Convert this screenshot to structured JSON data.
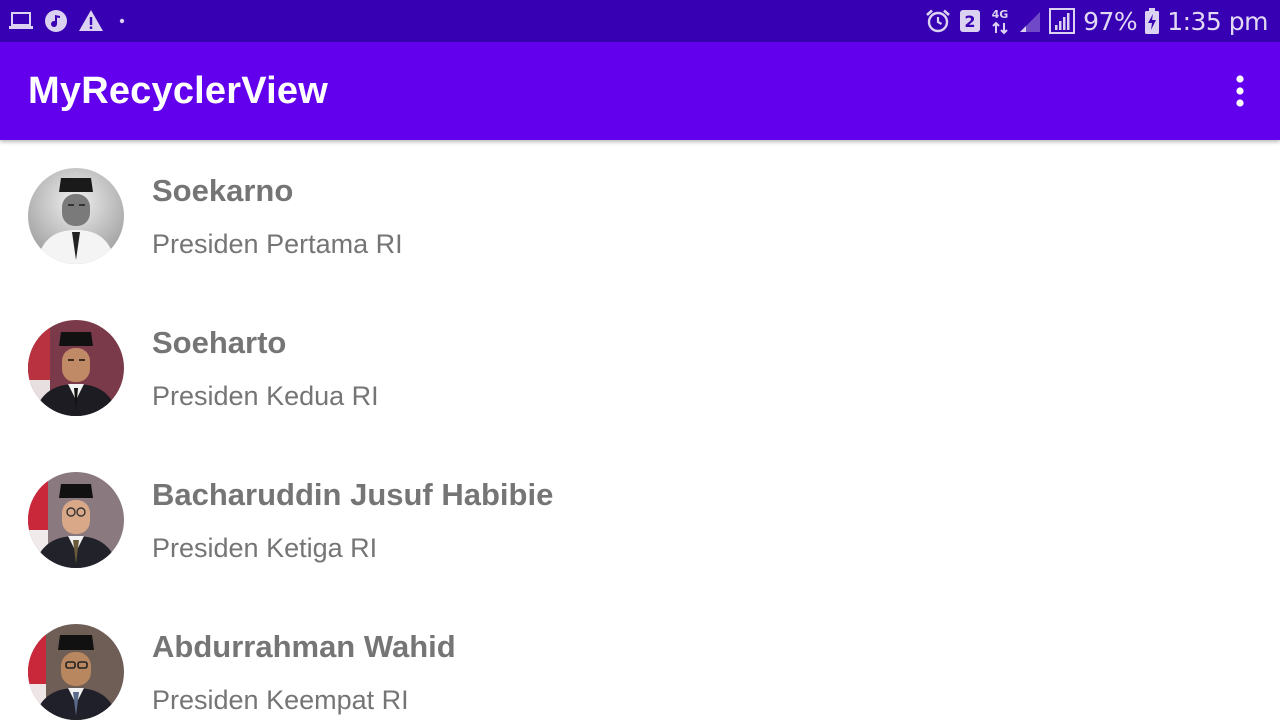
{
  "status_bar": {
    "left_icons": [
      "laptop-icon",
      "music-icon",
      "warning-icon",
      "dot-icon"
    ],
    "right_icons": [
      "alarm-icon",
      "sim2-badge-icon",
      "4g-data-icon",
      "signal-weak-icon",
      "signal-icon",
      "battery-charging-icon"
    ],
    "sim_badge": "2",
    "network_label": "4G",
    "battery": "97%",
    "time": "1:35 pm",
    "color": "#3700b3"
  },
  "app_bar": {
    "title": "MyRecyclerView",
    "menu_icon": "more-vert-icon",
    "color": "#6200ee"
  },
  "list": {
    "items": [
      {
        "name": "Soekarno",
        "description": "Presiden Pertama RI",
        "avatar": "portrait-soekarno"
      },
      {
        "name": "Soeharto",
        "description": "Presiden Kedua RI",
        "avatar": "portrait-soeharto"
      },
      {
        "name": "Bacharuddin Jusuf Habibie",
        "description": "Presiden Ketiga RI",
        "avatar": "portrait-habibie"
      },
      {
        "name": "Abdurrahman Wahid",
        "description": "Presiden Keempat RI",
        "avatar": "portrait-wahid"
      }
    ]
  }
}
